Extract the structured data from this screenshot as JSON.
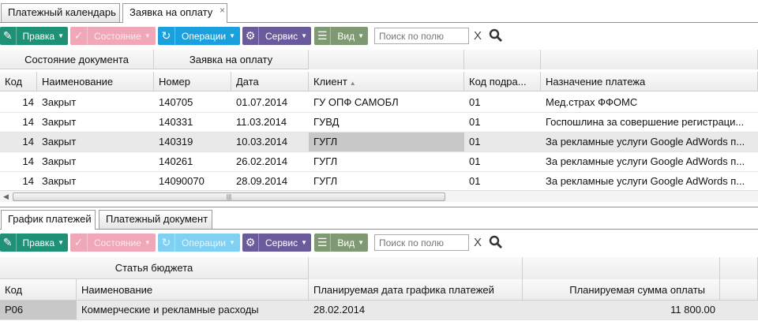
{
  "top_tabs": [
    {
      "label": "Платежный календарь",
      "active": false
    },
    {
      "label": "Заявка на оплату",
      "active": true,
      "close": "×"
    }
  ],
  "toolbar": {
    "edit": "Правка",
    "state": "Состояние",
    "operations": "Операции",
    "service": "Сервис",
    "view": "Вид",
    "search_placeholder": "Поиск по полю",
    "clear": "X"
  },
  "top_grid": {
    "group_headers": {
      "doc_state": "Состояние документа",
      "request": "Заявка на оплату"
    },
    "columns": [
      "Код",
      "Наименование",
      "Номер",
      "Дата",
      "Клиент",
      "Код подра...",
      "Назначение платежа"
    ],
    "sort_indicator": "▲",
    "rows": [
      [
        "14",
        "Закрыт",
        "140705",
        "01.07.2014",
        "ГУ ОПФ САМОБЛ",
        "01",
        "Мед.страх ФФОМС"
      ],
      [
        "14",
        "Закрыт",
        "140331",
        "11.03.2014",
        "ГУВД",
        "01",
        "Госпошлина за совершение регистраци..."
      ],
      [
        "14",
        "Закрыт",
        "140319",
        "10.03.2014",
        "ГУГЛ",
        "01",
        "За рекламные услуги Google AdWords п..."
      ],
      [
        "14",
        "Закрыт",
        "140261",
        "26.02.2014",
        "ГУГЛ",
        "01",
        "За рекламные услуги Google AdWords п..."
      ],
      [
        "14",
        "Закрыт",
        "14090070",
        "28.09.2014",
        "ГУГЛ",
        "01",
        "За рекламные услуги Google AdWords п..."
      ]
    ],
    "scroll_grip": "|||"
  },
  "bottom_tabs": [
    {
      "label": "График платежей",
      "active": true
    },
    {
      "label": "Платежный документ",
      "active": false
    }
  ],
  "bottom_grid": {
    "group_header": "Статья бюджета",
    "columns": [
      "Код",
      "Наименование",
      "Планируемая дата графика платежей",
      "Планируемая сумма оплаты"
    ],
    "rows": [
      [
        "Р06",
        "Коммерческие и рекламные расходы",
        "28.02.2014",
        "11 800.00"
      ]
    ]
  },
  "colors": {
    "edit": "#1f9176",
    "state": "#f0a8b8",
    "operations": "#1aa0dc",
    "service": "#6a5c9c",
    "view": "#7f9a73"
  }
}
